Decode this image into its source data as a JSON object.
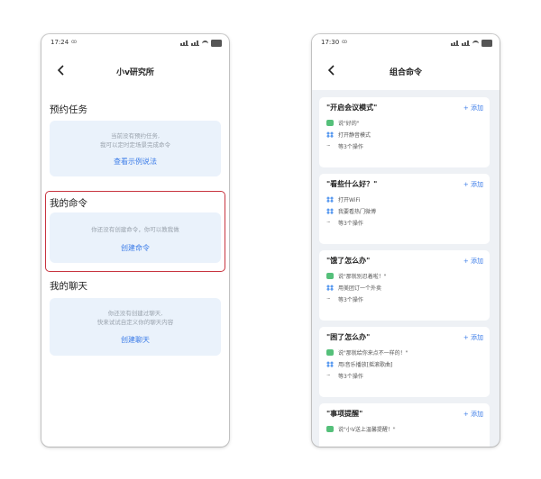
{
  "left_screen": {
    "status": {
      "time": "17:24",
      "time_extra": "ꝏ"
    },
    "nav": {
      "title": "小v研究所"
    },
    "scheduled": {
      "title": "预约任务",
      "desc_line1": "当前没有预约任务,",
      "desc_line2": "我可以定时定场景完成命令",
      "link": "查看示例说法"
    },
    "commands": {
      "title": "我的命令",
      "desc": "你还没有创建命令，你可以教我做",
      "link": "创建命令"
    },
    "chat": {
      "title": "我的聊天",
      "desc_line1": "你还没有创建过聊天,",
      "desc_line2": "快来试试自定义你的聊天内容",
      "link": "创建聊天"
    }
  },
  "right_screen": {
    "status": {
      "time": "17:30",
      "time_extra": "ꝏ"
    },
    "nav": {
      "title": "组合命令"
    },
    "add_label": "+ 添加",
    "cards": [
      {
        "title": "\"开启会议模式\"",
        "lines": [
          {
            "icon": "chat-icon",
            "text": "说\"好的\""
          },
          {
            "icon": "grid-icon",
            "text": "打开静音模式"
          },
          {
            "icon": "more-icon",
            "text": "等3个操作"
          }
        ]
      },
      {
        "title": "\"看些什么好？\"",
        "lines": [
          {
            "icon": "grid-icon",
            "text": "打开WiFi"
          },
          {
            "icon": "grid-icon",
            "text": "我要看热门微博"
          },
          {
            "icon": "more-icon",
            "text": "等3个操作"
          }
        ]
      },
      {
        "title": "\"饿了怎么办\"",
        "lines": [
          {
            "icon": "chat-icon",
            "text": "说\"那就别忍着啦！\""
          },
          {
            "icon": "grid-icon",
            "text": "用美团订一个外卖"
          },
          {
            "icon": "more-icon",
            "text": "等3个操作"
          }
        ]
      },
      {
        "title": "\"困了怎么办\"",
        "lines": [
          {
            "icon": "chat-icon",
            "text": "说\"那就给你来点不一样的！\""
          },
          {
            "icon": "grid-icon",
            "text": "用i音乐播放[摇滚歌曲]"
          },
          {
            "icon": "more-icon",
            "text": "等3个操作"
          }
        ]
      },
      {
        "title": "\"事项提醒\"",
        "lines": [
          {
            "icon": "chat-icon",
            "text": "说\"小V送上温馨提醒！\""
          }
        ]
      }
    ]
  },
  "colors": {
    "accent": "#3d7de8",
    "highlight": "#c8343f",
    "card_bg": "#eaf2fb"
  }
}
